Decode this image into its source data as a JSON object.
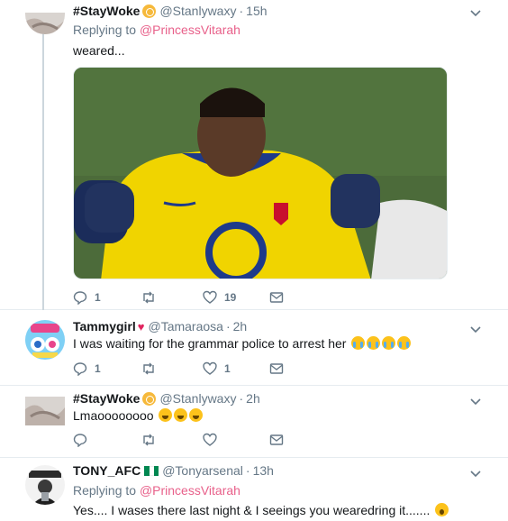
{
  "tweets": [
    {
      "name": "#StayWoke",
      "handle": "@Stanlywaxy",
      "time": "15h",
      "replying_prefix": "Replying to",
      "replying_to": "@PrincessVitarah",
      "text": "weared...",
      "media_icon": "jersey-photo",
      "reply_count": "1",
      "retweet_count": "",
      "like_count": "19"
    },
    {
      "name": "Tammygirl",
      "handle": "@Tamaraosa",
      "time": "2h",
      "text": "I was waiting for the grammar police to arrest her",
      "emojis": "😭😭😭😭",
      "reply_count": "1",
      "retweet_count": "",
      "like_count": "1"
    },
    {
      "name": "#StayWoke",
      "handle": "@Stanlywaxy",
      "time": "2h",
      "text": "Lmaoooooooo",
      "emojis": "😂😂😂",
      "reply_count": "",
      "retweet_count": "",
      "like_count": ""
    },
    {
      "name": "TONY_AFC",
      "handle": "@Tonyarsenal",
      "time": "13h",
      "replying_prefix": "Replying to",
      "replying_to": "@PrincessVitarah",
      "text": "Yes.... I wases there last night & I seeings you wearedring it.......",
      "emojis": "😱"
    }
  ],
  "separator": "·",
  "colors": {
    "reply_link": "#e8608a",
    "muted": "#657786",
    "thread_line": "#ccd6dd"
  }
}
